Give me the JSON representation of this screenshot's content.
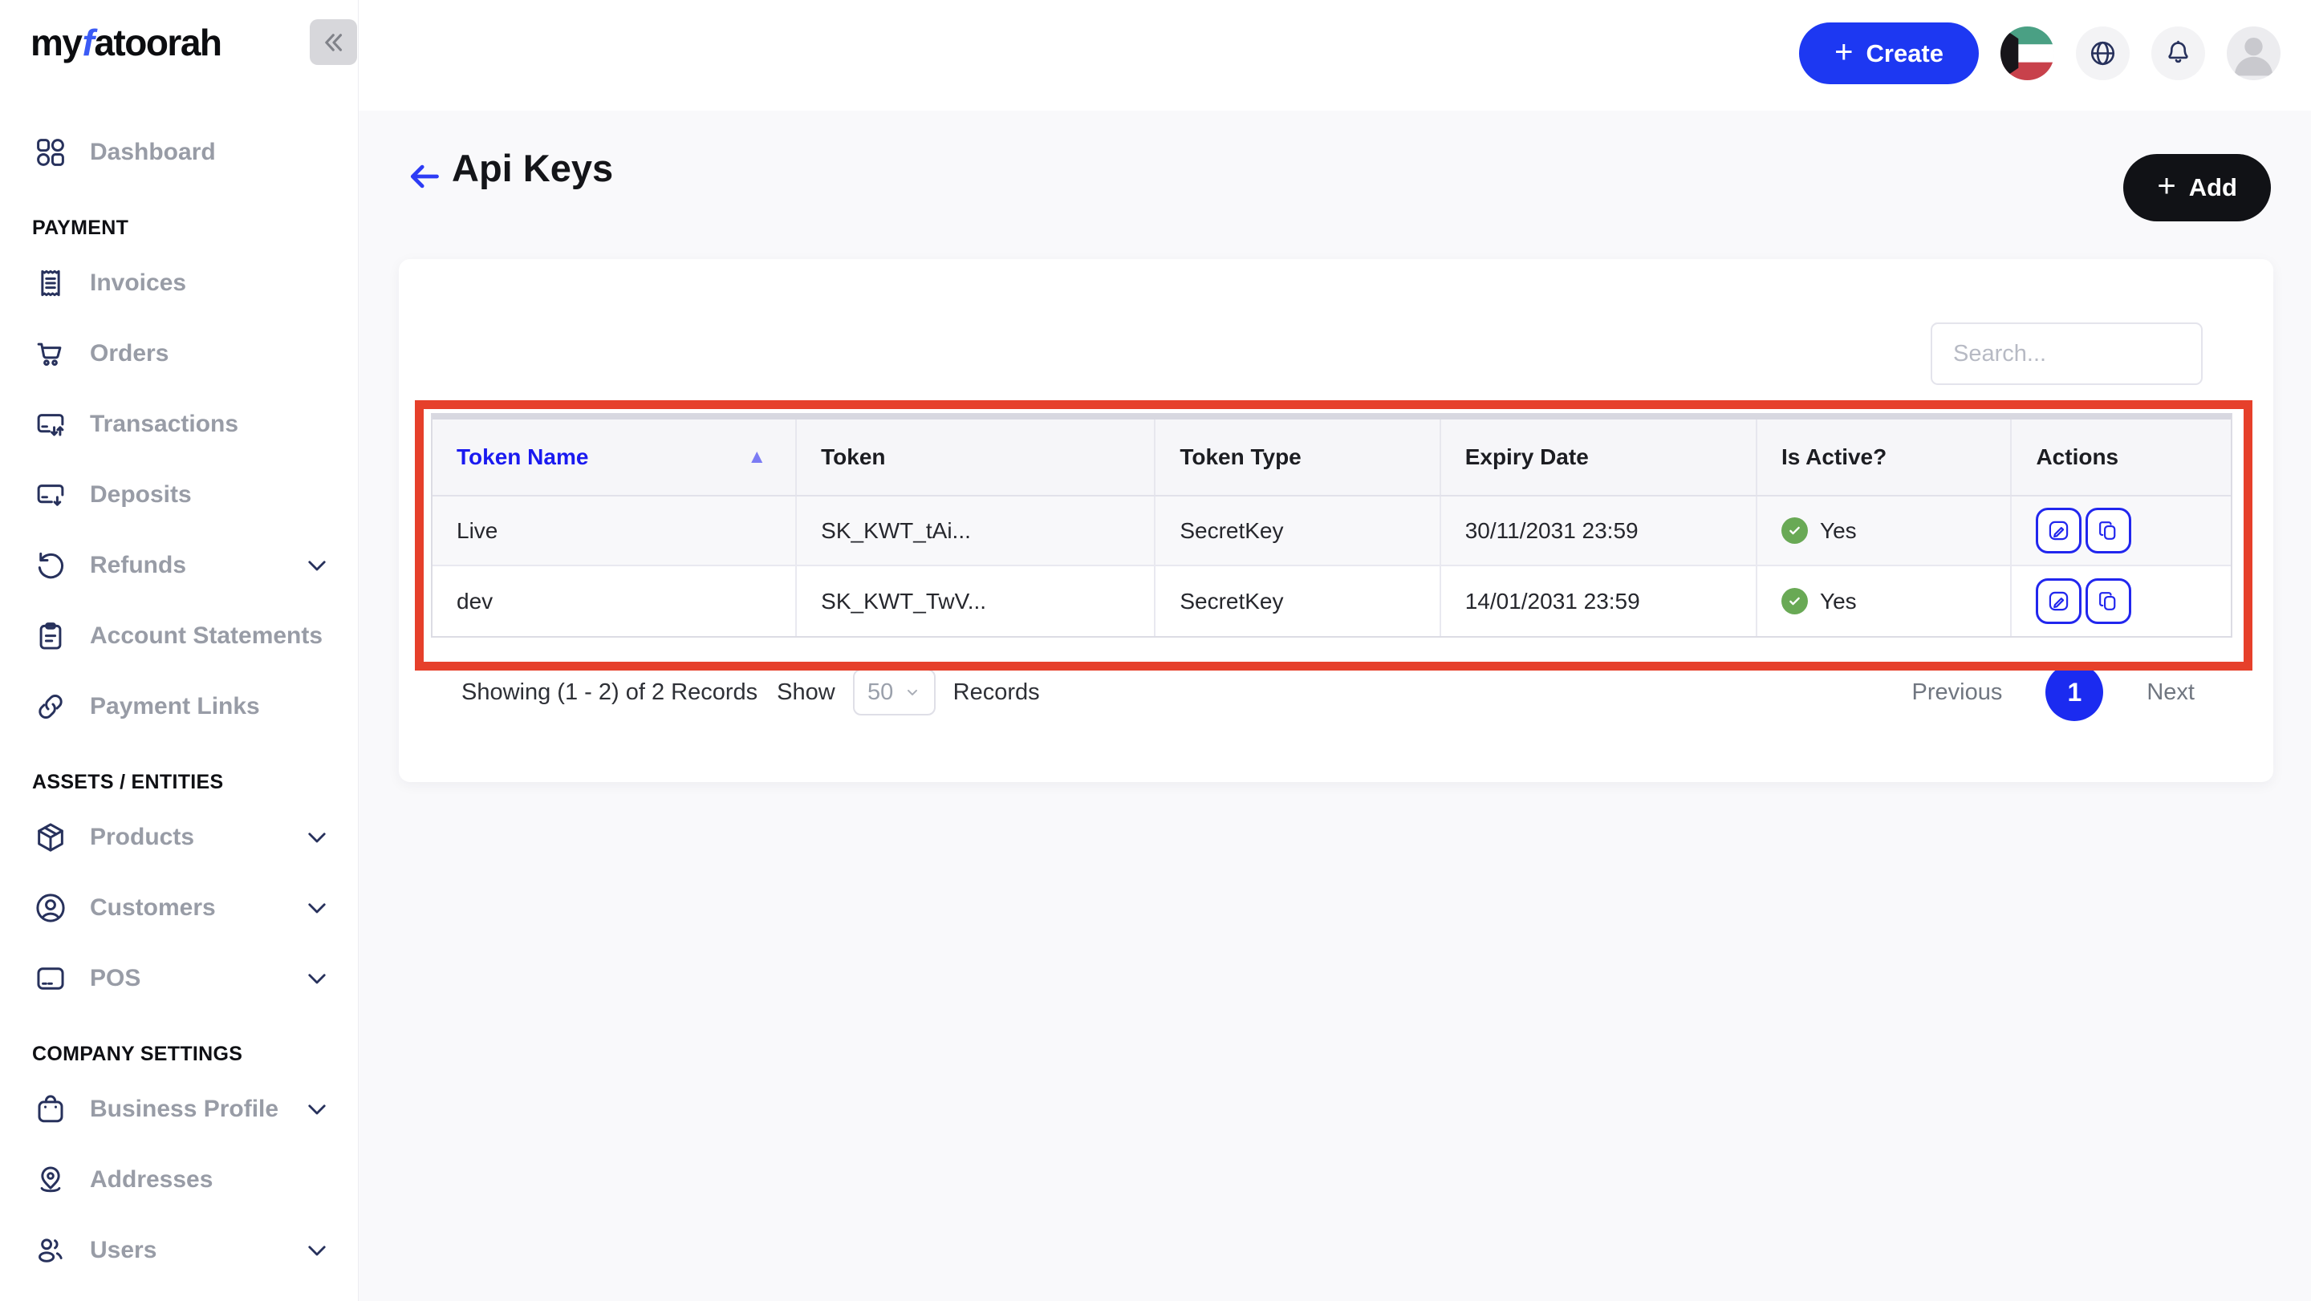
{
  "brand": {
    "part1": "my",
    "part2": "f",
    "part3": "atoorah"
  },
  "colors": {
    "accent_blue": "#1d38f2",
    "link_blue": "#1a1af0",
    "annotation_red": "#e6402b",
    "success_green": "#69a955",
    "dark_button": "#111216",
    "icon_navy": "#27315c"
  },
  "topbar": {
    "create_label": "Create"
  },
  "sidebar": {
    "sections": [
      {
        "header": "",
        "items": [
          {
            "label": "Dashboard",
            "icon": "dashboard",
            "chevron": false
          }
        ]
      },
      {
        "header": "PAYMENT",
        "items": [
          {
            "label": "Invoices",
            "icon": "invoices",
            "chevron": false
          },
          {
            "label": "Orders",
            "icon": "orders",
            "chevron": false
          },
          {
            "label": "Transactions",
            "icon": "transactions",
            "chevron": false
          },
          {
            "label": "Deposits",
            "icon": "deposits",
            "chevron": false
          },
          {
            "label": "Refunds",
            "icon": "refunds",
            "chevron": true
          },
          {
            "label": "Account Statements",
            "icon": "account-statements",
            "chevron": false
          },
          {
            "label": "Payment Links",
            "icon": "payment-links",
            "chevron": false
          }
        ]
      },
      {
        "header": "ASSETS / ENTITIES",
        "items": [
          {
            "label": "Products",
            "icon": "products",
            "chevron": true
          },
          {
            "label": "Customers",
            "icon": "customers",
            "chevron": true
          },
          {
            "label": "POS",
            "icon": "pos",
            "chevron": true
          }
        ]
      },
      {
        "header": "COMPANY SETTINGS",
        "items": [
          {
            "label": "Business Profile",
            "icon": "business-profile",
            "chevron": true
          },
          {
            "label": "Addresses",
            "icon": "addresses",
            "chevron": false
          },
          {
            "label": "Users",
            "icon": "users",
            "chevron": true
          }
        ]
      }
    ]
  },
  "page": {
    "title": "Api Keys",
    "add_label": "Add"
  },
  "search": {
    "placeholder": "Search..."
  },
  "table": {
    "columns": [
      {
        "label": "Token Name",
        "sorted": true
      },
      {
        "label": "Token",
        "sorted": false
      },
      {
        "label": "Token Type",
        "sorted": false
      },
      {
        "label": "Expiry Date",
        "sorted": false
      },
      {
        "label": "Is Active?",
        "sorted": false
      },
      {
        "label": "Actions",
        "sorted": false
      }
    ],
    "rows": [
      {
        "token_name": "Live",
        "token": "SK_KWT_tAi...",
        "token_type": "SecretKey",
        "expiry": "30/11/2031 23:59",
        "active": "Yes"
      },
      {
        "token_name": "dev",
        "token": "SK_KWT_TwV...",
        "token_type": "SecretKey",
        "expiry": "14/01/2031 23:59",
        "active": "Yes"
      }
    ]
  },
  "pagination": {
    "showing": "Showing (1 - 2) of 2 Records",
    "show_label": "Show",
    "page_size": "50",
    "records_label": "Records",
    "previous_label": "Previous",
    "current_page": "1",
    "next_label": "Next"
  }
}
